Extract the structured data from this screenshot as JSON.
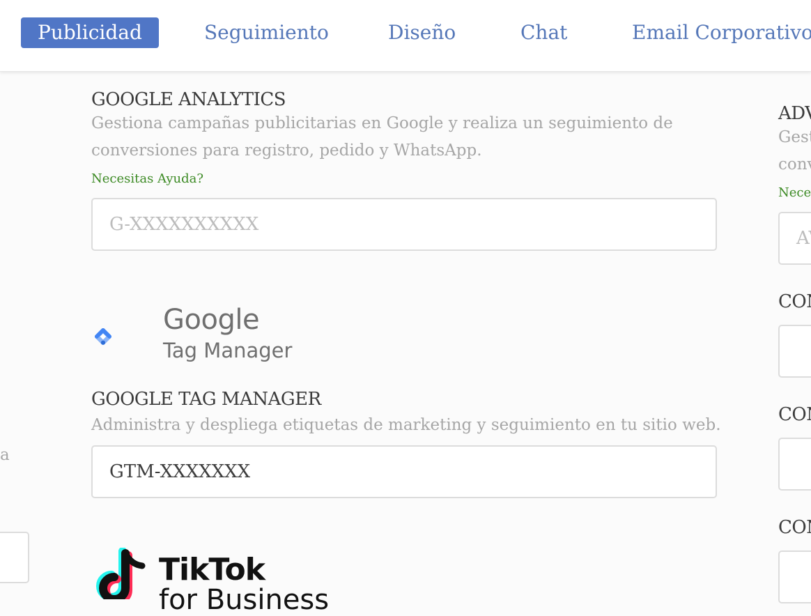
{
  "nav": {
    "tabs": [
      {
        "label": "Publicidad",
        "active": true
      },
      {
        "label": "Seguimiento",
        "active": false
      },
      {
        "label": "Diseño",
        "active": false
      },
      {
        "label": "Chat",
        "active": false
      },
      {
        "label": "Email Corporativo",
        "active": false
      }
    ]
  },
  "google_analytics": {
    "title": "GOOGLE ANALYTICS",
    "description_line1": "Gestiona campañas publicitarias en Google y realiza un seguimiento de",
    "description_line2": "conversiones para registro, pedido y WhatsApp.",
    "help_link": "Necesitas Ayuda?",
    "input_value": "",
    "input_placeholder": "G-XXXXXXXXXX"
  },
  "google_tag_manager": {
    "logo_word1": "Google",
    "logo_word2": "Tag Manager",
    "title": "GOOGLE TAG MANAGER",
    "description": "Administra y despliega etiquetas de marketing y seguimiento en tu sitio web.",
    "input_value": "GTM-XXXXXXX"
  },
  "tiktok": {
    "logo_word1": "TikTok",
    "logo_word2": "for Business"
  },
  "right_column": {
    "title_partial": "ADV",
    "desc_line1_partial": "Gest",
    "desc_line2_partial": "conv",
    "help_partial": "Neces",
    "input_placeholder_partial": "AV",
    "con_label_1": "CON",
    "con_label_2": "CON",
    "con_label_3": "CON"
  },
  "left_column": {
    "text_partial": "a"
  },
  "colors": {
    "accent": "#5076c6",
    "tab_text": "#5577b8",
    "help_green": "#3c8a24",
    "muted": "#a6a6a6"
  }
}
